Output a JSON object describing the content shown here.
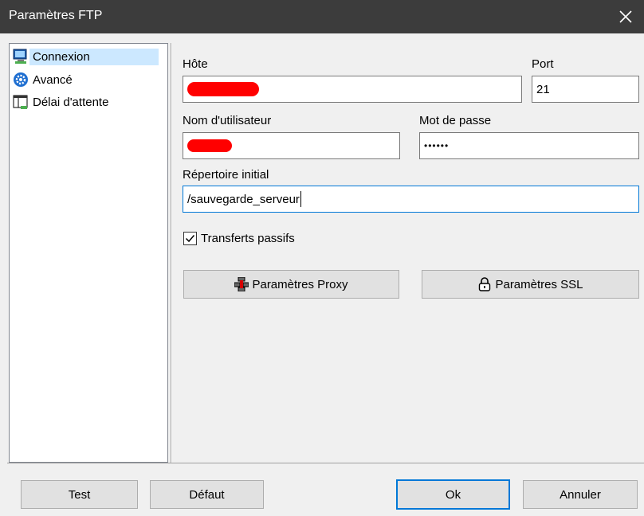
{
  "window": {
    "title": "Paramètres FTP",
    "close_glyph": "✕"
  },
  "tree": {
    "items": [
      {
        "label": "Connexion",
        "icon": "monitor-icon",
        "selected": true
      },
      {
        "label": "Avancé",
        "icon": "gear-icon",
        "selected": false
      },
      {
        "label": "Délai d'attente",
        "icon": "timeout-icon",
        "selected": false
      }
    ]
  },
  "form": {
    "host": {
      "label": "Hôte",
      "value": ""
    },
    "port": {
      "label": "Port",
      "value": "21"
    },
    "username": {
      "label": "Nom d'utilisateur",
      "value": ""
    },
    "password": {
      "label": "Mot de passe",
      "value": "••••••"
    },
    "initial_dir": {
      "label": "Répertoire initial",
      "value": "/sauvegarde_serveur"
    },
    "passive": {
      "label": "Transferts passifs",
      "checked": true
    }
  },
  "buttons": {
    "proxy": "Paramètres Proxy",
    "ssl": "Paramètres SSL",
    "test": "Test",
    "default": "Défaut",
    "ok": "Ok",
    "cancel": "Annuler"
  },
  "colors": {
    "titlebar": "#3c3c3c",
    "accent": "#0078d7",
    "redaction": "#ff0000",
    "selection": "#cce8ff"
  }
}
